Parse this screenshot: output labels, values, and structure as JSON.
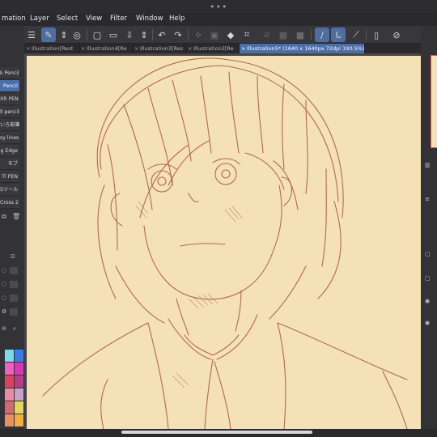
{
  "menu": {
    "items": [
      "mation",
      "Layer",
      "Select",
      "View",
      "Filter",
      "Window",
      "Help"
    ]
  },
  "toolbar": {
    "icons": [
      "menu-icon",
      "pen-tool-icon",
      "layer-move-icon",
      "new-canvas-icon",
      "open-file-icon",
      "save-icon",
      "undo-icon",
      "redo-icon",
      "selection-icon",
      "fill-icon",
      "transform-icon",
      "ruler-icon",
      "stabilizer-icon",
      "brush-size-icon",
      "device-icon",
      "settings-icon"
    ]
  },
  "tabs": [
    {
      "label": "Illustration[Rest"
    },
    {
      "label": "Illustration4[Re"
    },
    {
      "label": "Illustration3[Res"
    },
    {
      "label": "Illustration2[Re"
    },
    {
      "label": "Illustration5* (1640 x 1640px 72dpi 190.5%)",
      "active": true
    }
  ],
  "brushes": [
    {
      "label": "k Pencil"
    },
    {
      "label": "Pencil",
      "selected": true
    },
    {
      "label": "XR PEN"
    },
    {
      "label": "ll pencil"
    },
    {
      "label": "いろ鉛筆"
    },
    {
      "label": "sy lines"
    },
    {
      "label": "g Edge"
    },
    {
      "label": "モブ"
    },
    {
      "label": "TI PEN"
    },
    {
      "label": "Sツール"
    },
    {
      "label": "Cross 2"
    }
  ],
  "palette": {
    "colors": [
      "#7dd8e8",
      "#3a7ce8",
      "#f060c0",
      "#d838b8",
      "#e04060",
      "#b83a8a",
      "#e88aa8",
      "#c8a0c8",
      "#d86870",
      "#e0d85a",
      "#e89060",
      "#f0b040"
    ]
  },
  "canvas": {
    "paper_color": "#f4e1b6",
    "ink_color": "#a8553e"
  }
}
